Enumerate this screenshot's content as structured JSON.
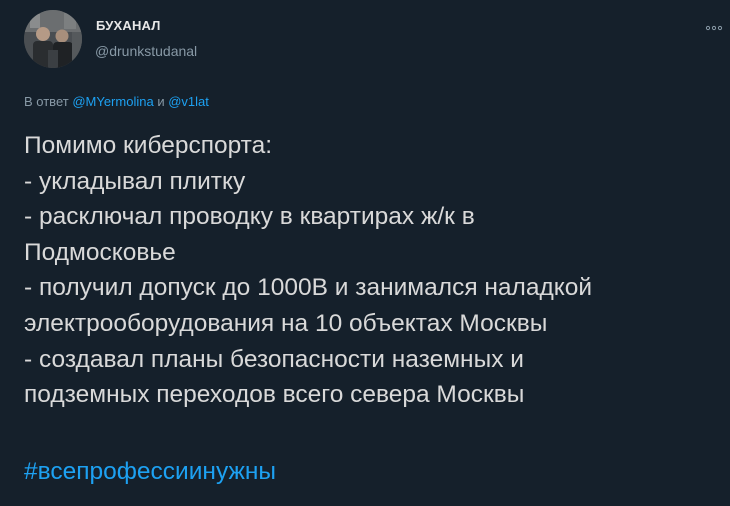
{
  "tweet": {
    "author": {
      "display_name": "БУХАНАЛ",
      "handle": "@drunkstudanal"
    },
    "more_icon": "ellipsis-icon",
    "reply": {
      "prefix": "В ответ",
      "mention_1": "@MYermolina",
      "separator": "и",
      "mention_2": "@v1lat"
    },
    "lines": [
      "Помимо киберспорта:",
      "- укладывал плитку",
      "- расключал проводку в квартирах ж/к в",
      "Подмосковье",
      "- получил допуск до 1000В и занимался наладкой",
      "электрооборудования на 10 объектах Москвы",
      "- создавал планы безопасности наземных и",
      "подземных переходов всего севера Москвы"
    ],
    "hashtag": "#всепрофессиинужны"
  },
  "colors": {
    "background": "#15202b",
    "text": "#d9d9d9",
    "secondary": "#8899a6",
    "accent": "#1da1f2"
  }
}
